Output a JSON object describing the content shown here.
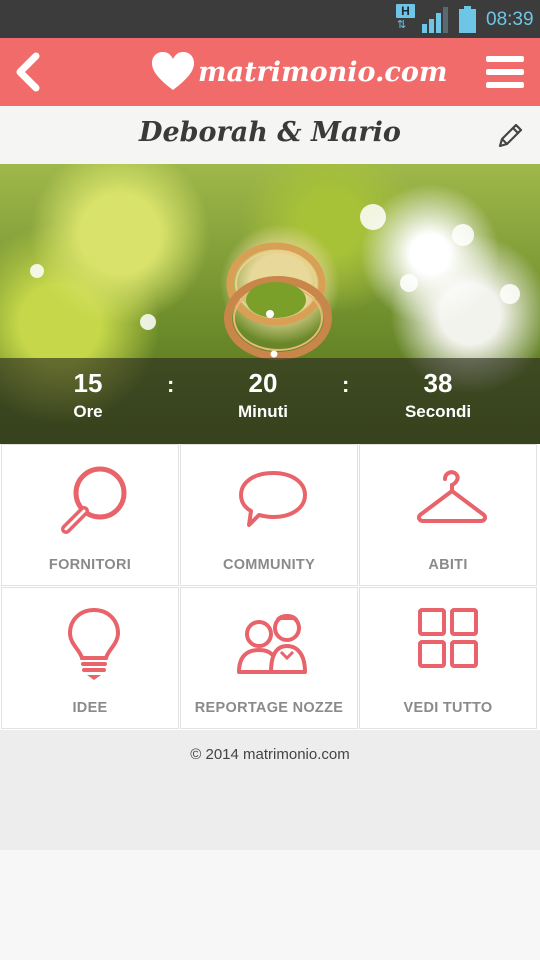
{
  "status_bar": {
    "network_badge": "H",
    "network_arrows": "⇅",
    "time": "08:39",
    "icons": [
      "signal-icon",
      "battery-icon"
    ]
  },
  "app_bar": {
    "logo_text": "matrimonio.com",
    "back_icon": "chevron-left-icon",
    "menu_icon": "hamburger-menu-icon",
    "color": "#f26b6b"
  },
  "couple": {
    "names": "Deborah & Mario",
    "edit_icon": "pencil-icon"
  },
  "countdown": {
    "items": [
      {
        "value": "15",
        "label": "Ore"
      },
      {
        "value": "20",
        "label": "Minuti"
      },
      {
        "value": "38",
        "label": "Secondi"
      }
    ],
    "separator": ":"
  },
  "menu_tiles": [
    {
      "label": "FORNITORI",
      "icon": "magnifier-icon"
    },
    {
      "label": "COMMUNITY",
      "icon": "speech-bubble-icon"
    },
    {
      "label": "ABITI",
      "icon": "hanger-icon"
    },
    {
      "label": "IDEE",
      "icon": "lightbulb-icon"
    },
    {
      "label": "REPORTAGE NOZZE",
      "icon": "couple-icon"
    },
    {
      "label": "VEDI TUTTO",
      "icon": "grid-icon"
    }
  ],
  "accent_color": "#e8636a",
  "footer": {
    "copyright": "© 2014 matrimonio.com"
  }
}
